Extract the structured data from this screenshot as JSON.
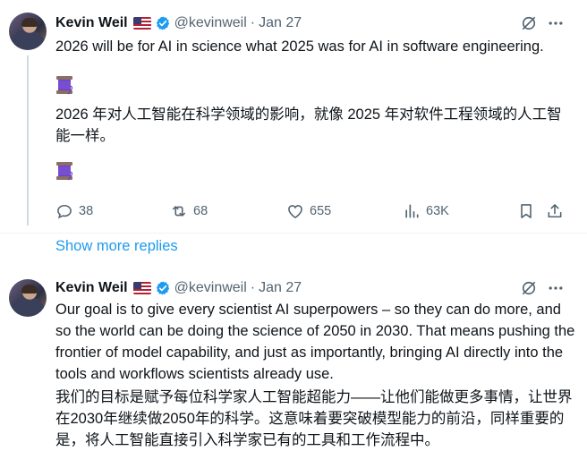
{
  "colors": {
    "text": "#0f1419",
    "muted": "#536471",
    "link": "#1d9bf0",
    "verified": "#1d9bf0"
  },
  "tweets": [
    {
      "author": {
        "name": "Kevin Weil",
        "handle": "@kevinweil",
        "date": "Jan 27"
      },
      "text_en": "2026 will be for AI in science what 2025 was for AI in software engineering.",
      "text_zh": "2026 年对人工智能在科学领域的影响，就像 2025 年对软件工程领域的人工智能一样。",
      "emoji": "spool-of-thread",
      "actions": {
        "replies": "38",
        "retweets": "68",
        "likes": "655",
        "views": "63K"
      }
    },
    {
      "author": {
        "name": "Kevin Weil",
        "handle": "@kevinweil",
        "date": "Jan 27"
      },
      "text_en": "Our goal is to give every scientist AI superpowers – so they can do more, and so the world can be doing the science of 2050 in 2030. That means pushing the frontier of model capability, and just as importantly, bringing AI directly into the tools and workflows scientists already use.",
      "text_zh": "我们的目标是赋予每位科学家人工智能超能力——让他们能做更多事情，让世界在2030年继续做2050年的科学。这意味着要突破模型能力的前沿，同样重要的是，将人工智能直接引入科学家已有的工具和工作流程中。"
    }
  ],
  "show_more": "Show more replies",
  "icons": [
    "grok-icon",
    "more-icon",
    "reply-icon",
    "retweet-icon",
    "like-icon",
    "views-icon",
    "bookmark-icon",
    "share-icon",
    "verified-icon",
    "us-flag-icon"
  ]
}
